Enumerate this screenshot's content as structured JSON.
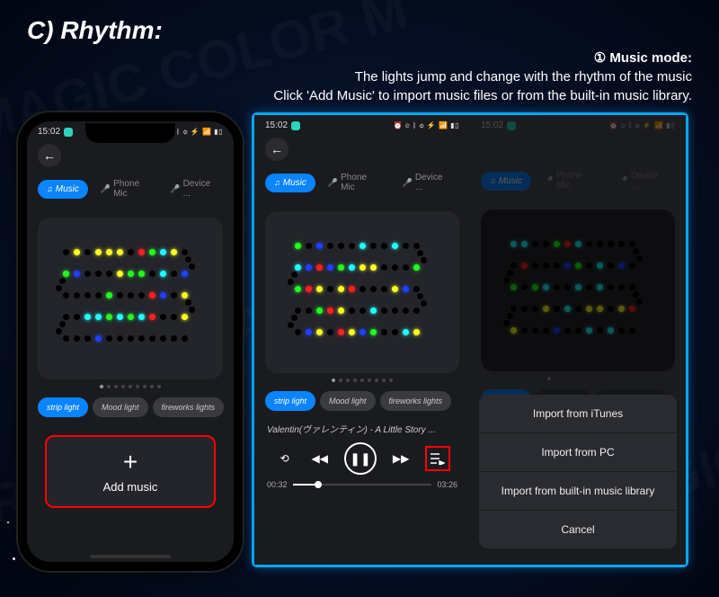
{
  "header": {
    "section": "C)  Rhythm:",
    "mode_label": "① Music mode:",
    "desc_line1": "The lights jump and change with the rhythm of the music",
    "desc_line2": "Click 'Add Music' to import music files or from the built-in music library."
  },
  "status": {
    "time": "15:02",
    "icons": "⏰ ⊘ ᛒ ⚙ ⚡ 📶 ▮▯"
  },
  "tabs": {
    "music": "Music",
    "phone_mic": "Phone Mic",
    "device": "Device ..."
  },
  "pills": {
    "strip": "strip light",
    "mood": "Mood light",
    "fireworks": "fireworks lights"
  },
  "add_music": {
    "label": "Add music"
  },
  "player": {
    "track": "Valentin(ヴァレンティン) - A Little Story ...",
    "elapsed": "00:32",
    "total": "03:26"
  },
  "import": {
    "itunes": "Import from iTunes",
    "pc": "Import from PC",
    "builtin": "Import from built-in music library",
    "cancel": "Cancel"
  }
}
